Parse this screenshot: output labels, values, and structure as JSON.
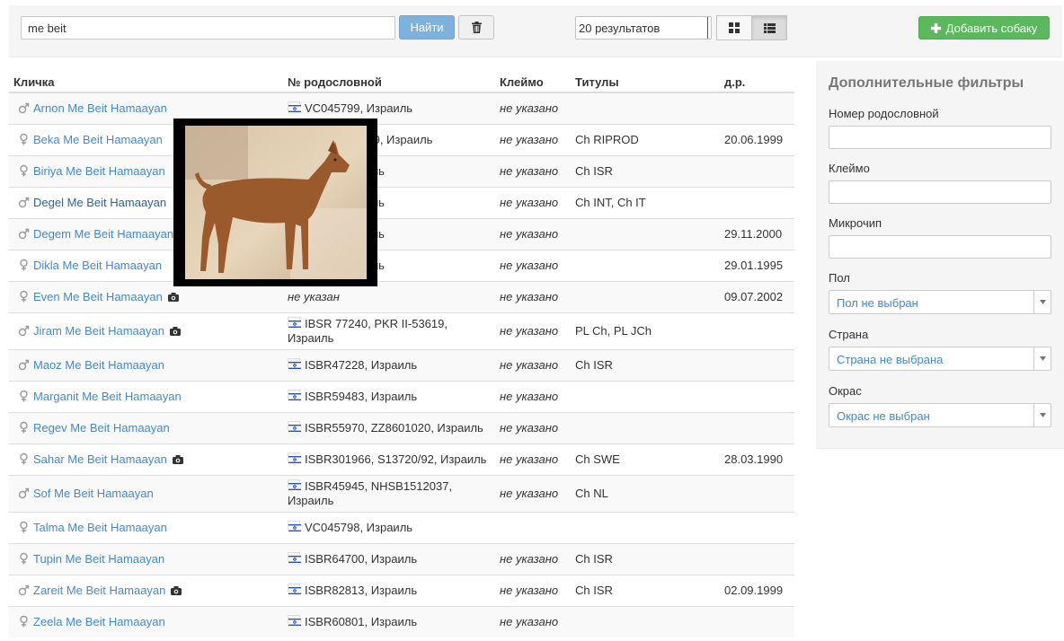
{
  "toolbar": {
    "search_value": "me beit",
    "find_label": "Найти",
    "results_count": "20 результатов",
    "add_label": "Добавить собаку"
  },
  "table": {
    "headers": {
      "name": "Кличка",
      "pedigree": "№ родословной",
      "brand": "Клеймо",
      "titles": "Титулы",
      "birth": "д.р."
    },
    "rows": [
      {
        "name": "Arnon Me Beit Hamaayan",
        "gender": "male",
        "photo": false,
        "flag": true,
        "pedigree": "VC045799, Израиль",
        "brand": "не указано",
        "titles": "",
        "birth": ""
      },
      {
        "name": "Beka Me Beit Hamaayan",
        "gender": "female",
        "photo": false,
        "flag": true,
        "pedigree": "ZZ9O0131249, Израиль",
        "brand": "не указано",
        "titles": "Ch RIPROD",
        "birth": "20.06.1999"
      },
      {
        "name": "Biriya Me Beit Hamaayan",
        "gender": "female",
        "photo": false,
        "flag": true,
        "pedigree": "ISBR, Израиль",
        "brand": "не указано",
        "titles": "Ch ISR",
        "birth": ""
      },
      {
        "name": "Degel Me Beit Hamaayan",
        "gender": "male",
        "photo": false,
        "flag": true,
        "pedigree": "ISBR, Израиль",
        "brand": "не указано",
        "titles": "Ch INT, Ch IT",
        "birth": ""
      },
      {
        "name": "Degem Me Beit Hamaayan",
        "gender": "male",
        "photo": false,
        "flag": true,
        "pedigree": "ISBR, Израиль",
        "brand": "не указано",
        "titles": "",
        "birth": "29.11.2000"
      },
      {
        "name": "Dikla Me Beit Hamaayan",
        "gender": "female",
        "photo": false,
        "flag": true,
        "pedigree": "ISBR, Израиль",
        "brand": "не указано",
        "titles": "",
        "birth": "29.01.1995"
      },
      {
        "name": "Even Me Beit Hamaayan",
        "gender": "female",
        "photo": true,
        "flag": false,
        "pedigree": "не указан",
        "brand": "не указано",
        "titles": "",
        "birth": "09.07.2002"
      },
      {
        "name": "Jiram Me Beit Hamaayan",
        "gender": "male",
        "photo": true,
        "flag": true,
        "pedigree": "IBSR 77240, PKR II-53619, Израиль",
        "brand": "не указано",
        "titles": "PL Ch, PL JCh",
        "birth": ""
      },
      {
        "name": "Maoz Me Beit Hamaayan",
        "gender": "male",
        "photo": false,
        "flag": true,
        "pedigree": "ISBR47228, Израиль",
        "brand": "не указано",
        "titles": "Ch ISR",
        "birth": ""
      },
      {
        "name": "Marganit Me Beit Hamaayan",
        "gender": "female",
        "photo": false,
        "flag": true,
        "pedigree": "ISBR59483, Израиль",
        "brand": "не указано",
        "titles": "",
        "birth": ""
      },
      {
        "name": "Regev Me Beit Hamaayan",
        "gender": "female",
        "photo": false,
        "flag": true,
        "pedigree": "ISBR55970, ZZ8601020, Израиль",
        "brand": "не указано",
        "titles": "",
        "birth": ""
      },
      {
        "name": "Sahar Me Beit Hamaayan",
        "gender": "female",
        "photo": true,
        "flag": true,
        "pedigree": "ISBR301966, S13720/92, Израиль",
        "brand": "не указано",
        "titles": "Ch SWE",
        "birth": "28.03.1990"
      },
      {
        "name": "Sof Me Beit Hamaayan",
        "gender": "male",
        "photo": false,
        "flag": true,
        "pedigree": "ISBR45945, NHSB1512037, Израиль",
        "brand": "не указано",
        "titles": "Ch NL",
        "birth": ""
      },
      {
        "name": "Talma Me Beit Hamaayan",
        "gender": "female",
        "photo": false,
        "flag": true,
        "pedigree": "VC045798, Израиль",
        "brand": "",
        "titles": "",
        "birth": ""
      },
      {
        "name": "Tupin Me Beit Hamaayan",
        "gender": "female",
        "photo": false,
        "flag": true,
        "pedigree": "ISBR64700, Израиль",
        "brand": "не указано",
        "titles": "Ch ISR",
        "birth": ""
      },
      {
        "name": "Zareit Me Beit Hamaayan",
        "gender": "male",
        "photo": true,
        "flag": true,
        "pedigree": "ISBR82813, Израиль",
        "brand": "не указано",
        "titles": "Ch ISR",
        "birth": "02.09.1999"
      },
      {
        "name": "Zeela Me Beit Hamaayan",
        "gender": "female",
        "photo": false,
        "flag": true,
        "pedigree": "ISBR60801, Израиль",
        "brand": "не указано",
        "titles": "",
        "birth": ""
      }
    ]
  },
  "filters": {
    "title": "Дополнительные фильтры",
    "pedigree_label": "Номер родословной",
    "brand_label": "Клеймо",
    "microchip_label": "Микрочип",
    "gender_label": "Пол",
    "gender_value": "Пол не выбран",
    "country_label": "Страна",
    "country_value": "Страна не выбрана",
    "color_label": "Окрас",
    "color_value": "Окрас не выбран"
  },
  "colors": {
    "link": "#428bca",
    "find_button": "#7db2df",
    "add_button": "#5cb85c"
  },
  "hovered_row_index": 3
}
